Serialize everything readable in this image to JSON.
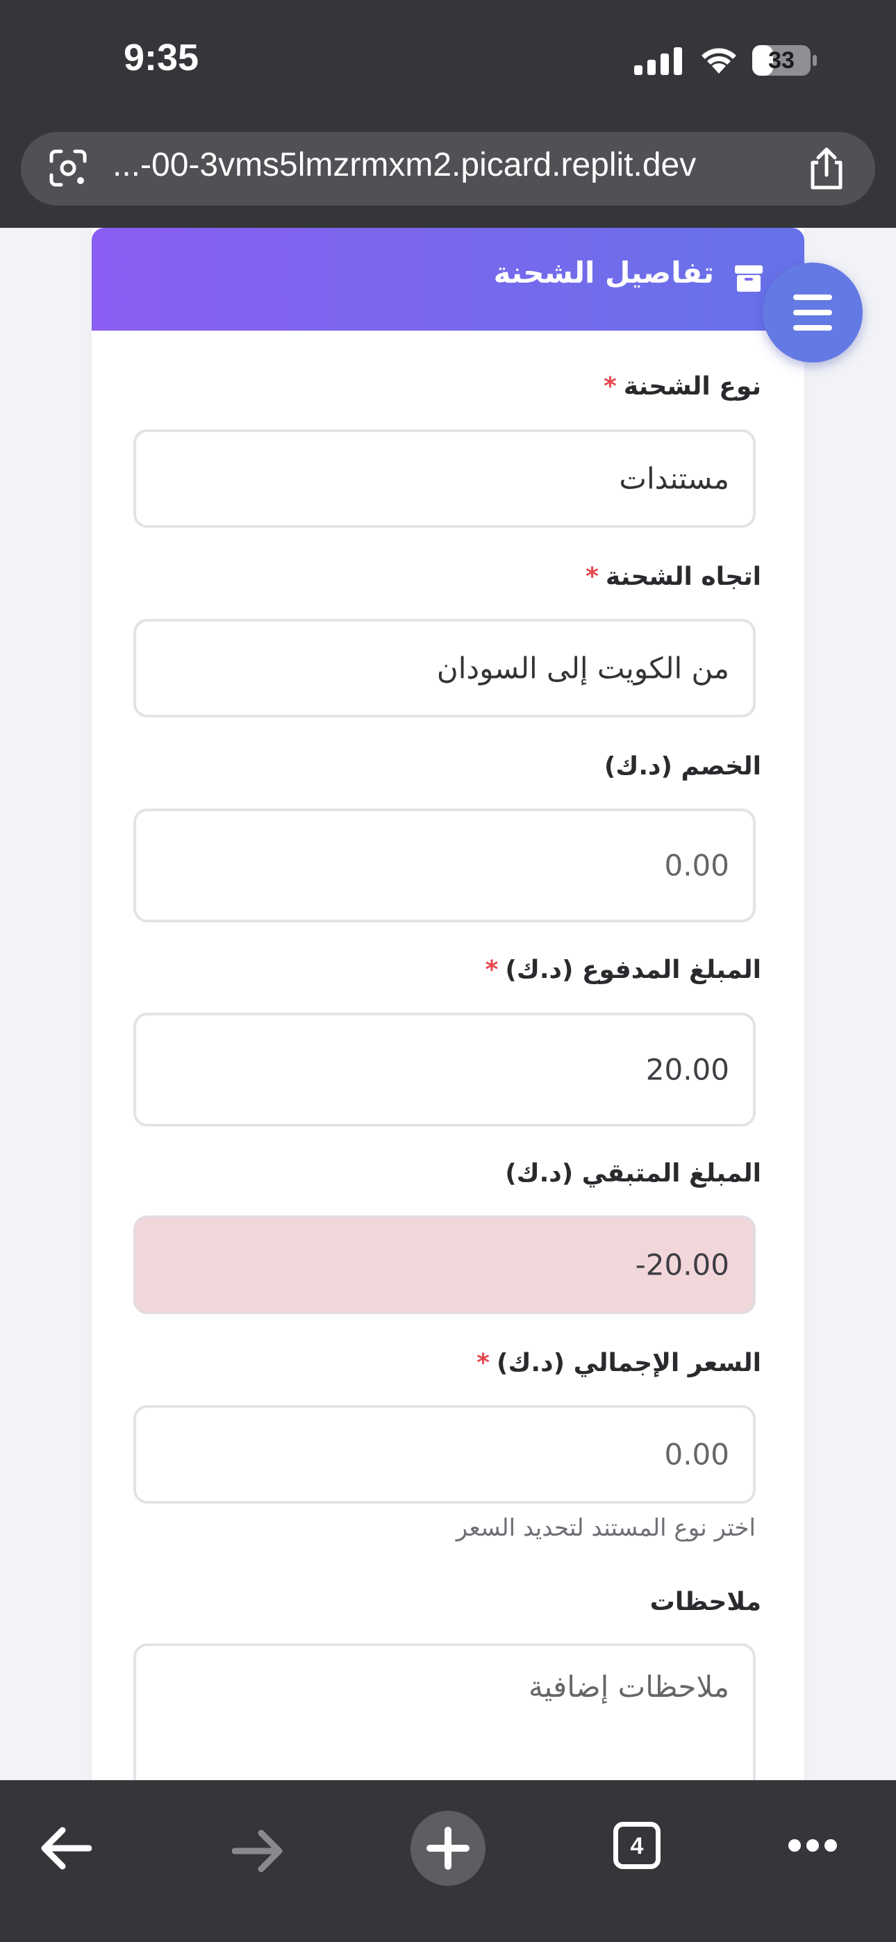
{
  "status_bar": {
    "time": "9:35",
    "battery": "33"
  },
  "browser": {
    "url": "...-00-3vms5lmzrmxm2.picard.replit.dev",
    "tab_count": "4"
  },
  "card": {
    "title": "تفاصيل الشحنة"
  },
  "fields": {
    "shipment_type": {
      "label": "نوع الشحنة",
      "required_mark": "*",
      "value": "مستندات"
    },
    "direction": {
      "label": "اتجاه الشحنة",
      "required_mark": "*",
      "value": "من الكويت إلى السودان"
    },
    "discount": {
      "label": "الخصم (د.ك)",
      "value": "0.00"
    },
    "paid_amount": {
      "label": "المبلغ المدفوع (د.ك)",
      "required_mark": "*",
      "value": "20.00"
    },
    "remaining_amount": {
      "label": "المبلغ المتبقي (د.ك)",
      "value": "-20.00"
    },
    "total_price": {
      "label": "السعر الإجمالي (د.ك)",
      "required_mark": "*",
      "value": "0.00",
      "hint": "اختر نوع المستند لتحديد السعر"
    },
    "notes": {
      "label": "ملاحظات",
      "placeholder": "ملاحظات إضافية"
    }
  },
  "colors": {
    "header_gradient_start": "#8a5ef2",
    "header_gradient_end": "#6772e8",
    "menu_button": "#6379e4",
    "required": "#e5484d",
    "negative_bg": "#f2d7da",
    "chrome": "#35363a"
  },
  "icons": [
    "signal-icon",
    "wifi-icon",
    "battery-icon",
    "lens-icon",
    "share-icon",
    "box-icon",
    "hamburger-icon",
    "back-icon",
    "forward-icon",
    "new-tab-icon",
    "tabs-icon",
    "more-icon"
  ]
}
